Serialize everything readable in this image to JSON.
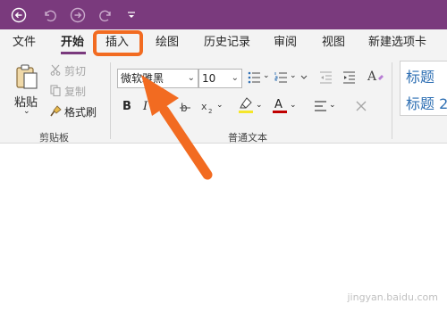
{
  "quick_access": {
    "back_icon": "back-circle-arrow",
    "undo_icon": "undo-arrow",
    "forward_icon": "forward-circle-arrow",
    "redo_icon": "redo-arrow",
    "customize_icon": "customize-dropdown"
  },
  "tabs": [
    {
      "label": "文件"
    },
    {
      "label": "开始",
      "active": true
    },
    {
      "label": "插入",
      "highlighted": true
    },
    {
      "label": "绘图"
    },
    {
      "label": "历史记录"
    },
    {
      "label": "审阅"
    },
    {
      "label": "视图"
    },
    {
      "label": "新建选项卡"
    }
  ],
  "clipboard": {
    "paste_label": "粘贴",
    "cut_label": "剪切",
    "copy_label": "复制",
    "format_painter_label": "格式刷",
    "group_label": "剪贴板"
  },
  "basic_text": {
    "font_name": "微软雅黑",
    "font_size": "10",
    "bold_label": "B",
    "italic_label": "I",
    "group_label": "普通文本",
    "highlight_color": "#f5e62a",
    "font_color": "#c00000"
  },
  "styles": {
    "items": [
      "标题",
      "标题 2"
    ]
  },
  "annotation": {
    "color": "#f26b21"
  },
  "watermark": "jingyan.baidu.com"
}
